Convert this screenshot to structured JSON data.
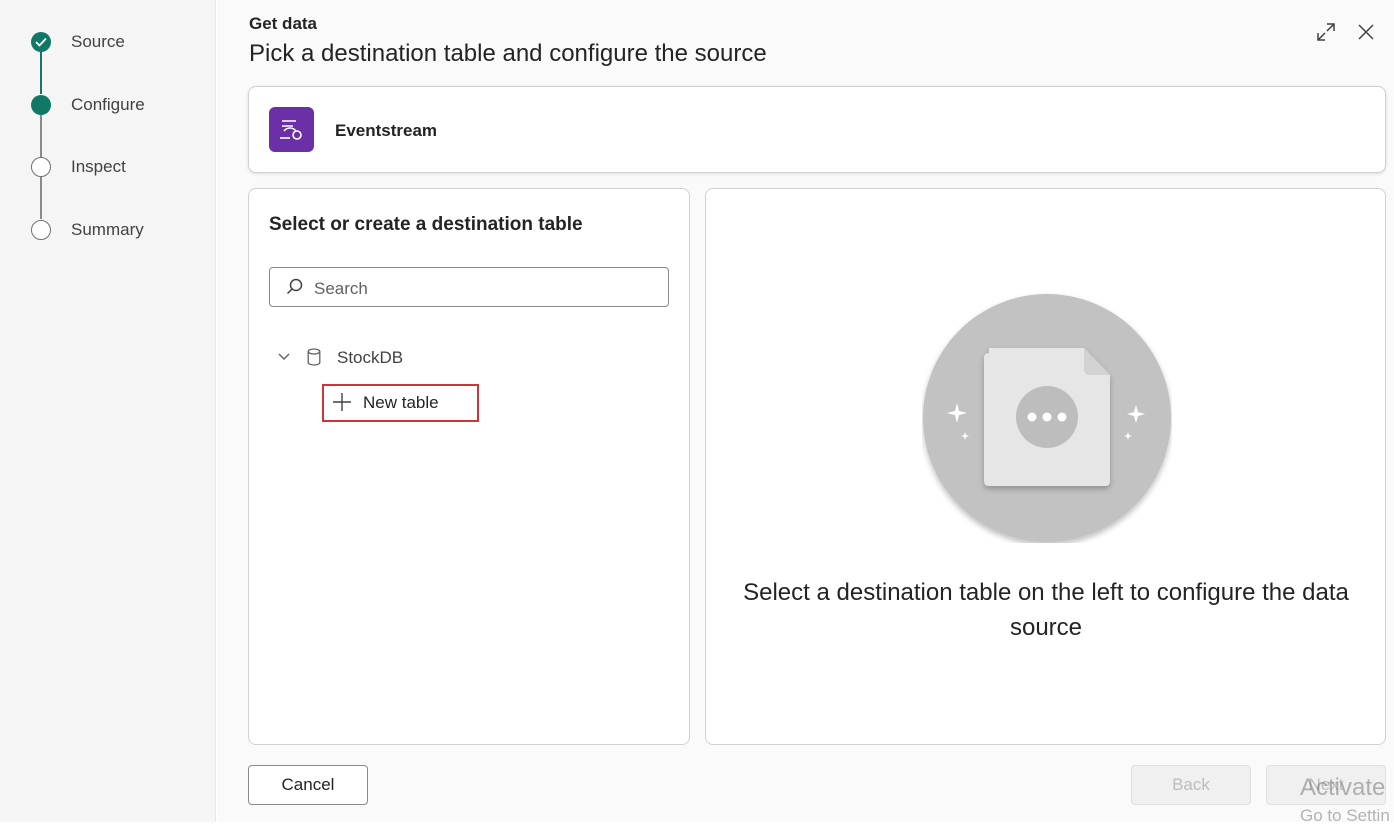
{
  "steps": [
    {
      "label": "Source",
      "state": "done"
    },
    {
      "label": "Configure",
      "state": "active"
    },
    {
      "label": "Inspect",
      "state": "todo"
    },
    {
      "label": "Summary",
      "state": "todo"
    }
  ],
  "header": {
    "small_title": "Get data",
    "title": "Pick a destination table and configure the source",
    "expand_icon": "expand-icon",
    "close_icon": "close-icon"
  },
  "source": {
    "name": "Eventstream",
    "icon": "eventstream-icon",
    "icon_color": "#6b2fa8"
  },
  "left_panel": {
    "title": "Select or create a destination table",
    "search_placeholder": "Search",
    "search_value": "",
    "database": "StockDB",
    "new_table_label": "New table"
  },
  "right_panel": {
    "message": "Select a destination table on the left to configure the data source"
  },
  "footer": {
    "cancel": "Cancel",
    "back": "Back",
    "next": "Next"
  },
  "watermark": {
    "line1": "Activate",
    "line2": "Go to Settin"
  },
  "colors": {
    "accent": "#117865",
    "highlight": "#d13438"
  }
}
